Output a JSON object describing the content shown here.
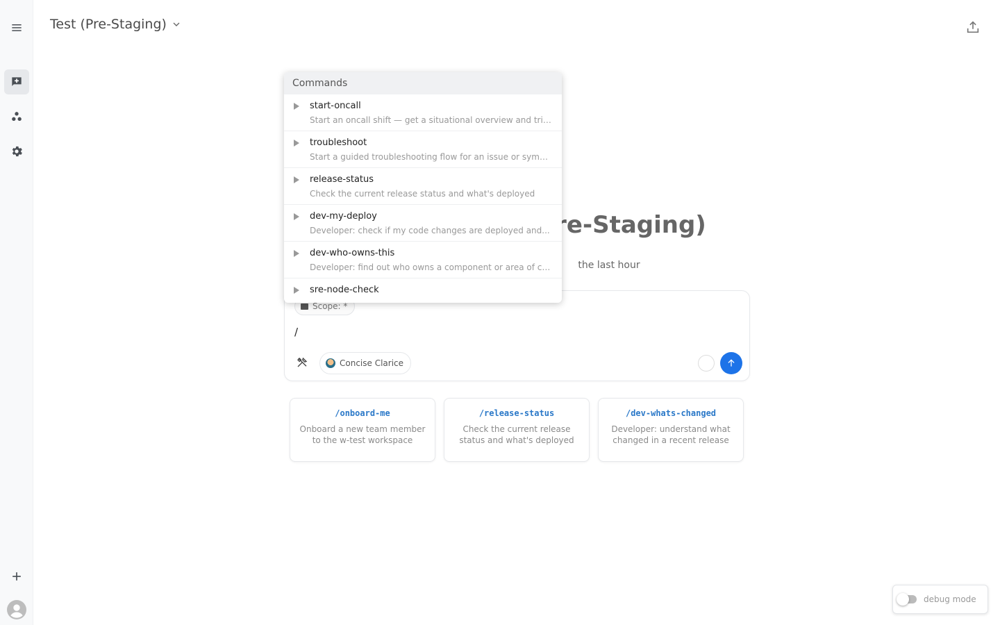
{
  "header": {
    "workspace_title": "Test (Pre-Staging)"
  },
  "hero": {
    "title": "re-Staging)",
    "subtitle": "the last hour"
  },
  "composer": {
    "scope_label": "Scope: *",
    "input_value": "/",
    "agent_name": "Concise Clarice"
  },
  "commands_popover": {
    "header": "Commands",
    "items": [
      {
        "name": "start-oncall",
        "description": "Start an oncall shift — get a situational overview and triage..."
      },
      {
        "name": "troubleshoot",
        "description": "Start a guided troubleshooting flow for an issue or symptom"
      },
      {
        "name": "release-status",
        "description": "Check the current release status and what's deployed"
      },
      {
        "name": "dev-my-deploy",
        "description": "Developer: check if my code changes are deployed and..."
      },
      {
        "name": "dev-who-owns-this",
        "description": "Developer: find out who owns a component or area of code"
      },
      {
        "name": "sre-node-check",
        "description": ""
      }
    ]
  },
  "suggestions": [
    {
      "command": "/onboard-me",
      "description": "Onboard a new team member to the w-test workspace"
    },
    {
      "command": "/release-status",
      "description": "Check the current release status and what's deployed"
    },
    {
      "command": "/dev-whats-changed",
      "description": "Developer: understand what changed in a recent release"
    }
  ],
  "debug": {
    "label": "debug mode",
    "enabled": false
  },
  "colors": {
    "accent": "#1d73e8",
    "command_link": "#2a78c8"
  }
}
